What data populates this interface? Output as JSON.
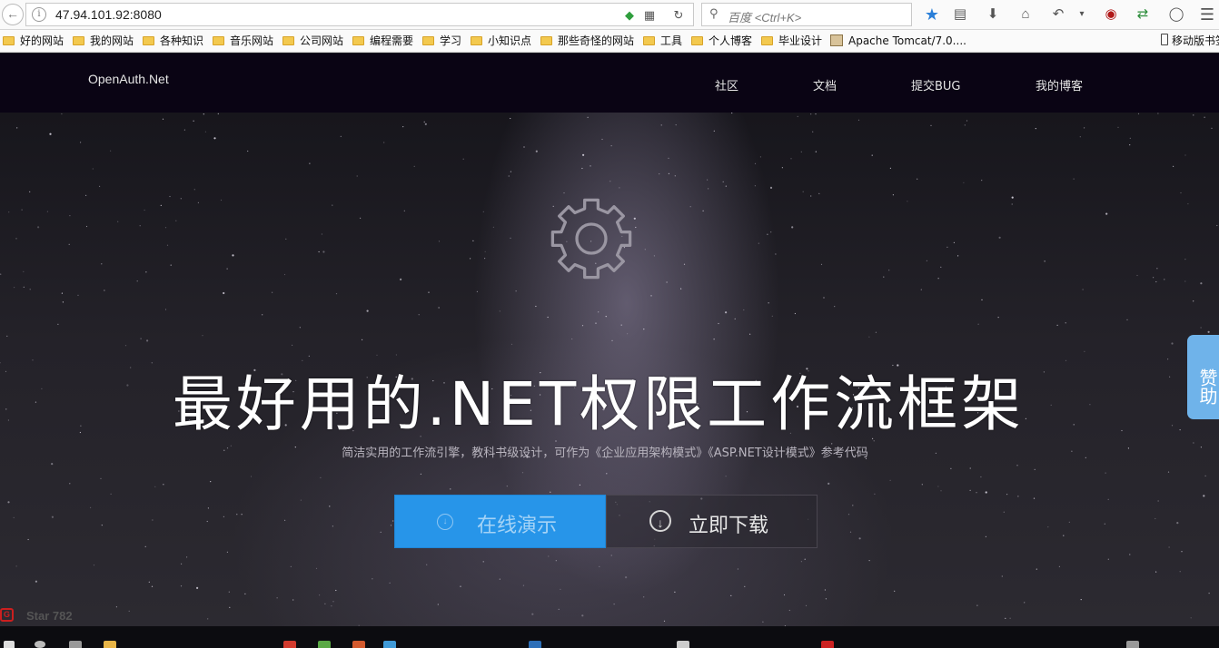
{
  "browser": {
    "url": "47.94.101.92:8080",
    "search_placeholder": "百度 <Ctrl+K>",
    "bookmarks": [
      "好的网站",
      "我的网站",
      "各种知识",
      "音乐网站",
      "公司网站",
      "编程需要",
      "学习",
      "小知识点",
      "那些奇怪的网站",
      "工具",
      "个人博客",
      "毕业设计",
      "Apache Tomcat/7.0....",
      "移动版书签"
    ]
  },
  "site": {
    "logo": "OpenAuth.Net",
    "nav": [
      "社区",
      "文档",
      "提交BUG",
      "我的博客"
    ]
  },
  "hero": {
    "title": "最好用的.NET权限工作流框架",
    "subtitle": "简洁实用的工作流引擎，教科书级设计，可作为《企业应用架构模式》《ASP.NET设计模式》参考代码",
    "demo_button": "在线演示",
    "download_button": "立即下载",
    "donate": "赞助",
    "github_badge": "Star 782"
  },
  "colors": {
    "header_bg": "#0a0414",
    "demo_button": "#2795e9",
    "donate_tab": "#6fb3ea"
  }
}
